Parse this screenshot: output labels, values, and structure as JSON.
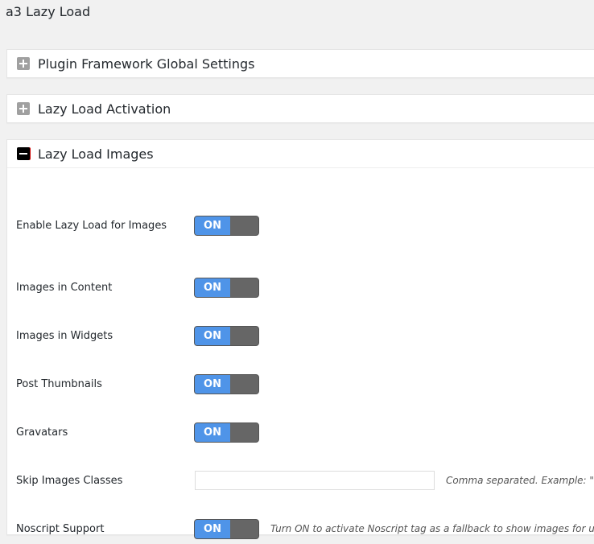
{
  "page_title": "a3 Lazy Load",
  "panels": [
    {
      "title": "Plugin Framework Global Settings",
      "state": "collapsed"
    },
    {
      "title": "Lazy Load Activation",
      "state": "collapsed"
    },
    {
      "title": "Lazy Load Images",
      "state": "expanded"
    }
  ],
  "settings": {
    "enable": {
      "label": "Enable Lazy Load for Images",
      "value": "ON"
    },
    "content": {
      "label": "Images in Content",
      "value": "ON"
    },
    "widgets": {
      "label": "Images in Widgets",
      "value": "ON"
    },
    "thumbs": {
      "label": "Post Thumbnails",
      "value": "ON"
    },
    "gravatars": {
      "label": "Gravatars",
      "value": "ON"
    },
    "skip": {
      "label": "Skip Images Classes",
      "value": "",
      "description": "Comma separated. Example: \"no-"
    },
    "noscript": {
      "label": "Noscript Support",
      "value": "ON",
      "description": "Turn ON to activate Noscript tag as a fallback to show images for users"
    }
  }
}
